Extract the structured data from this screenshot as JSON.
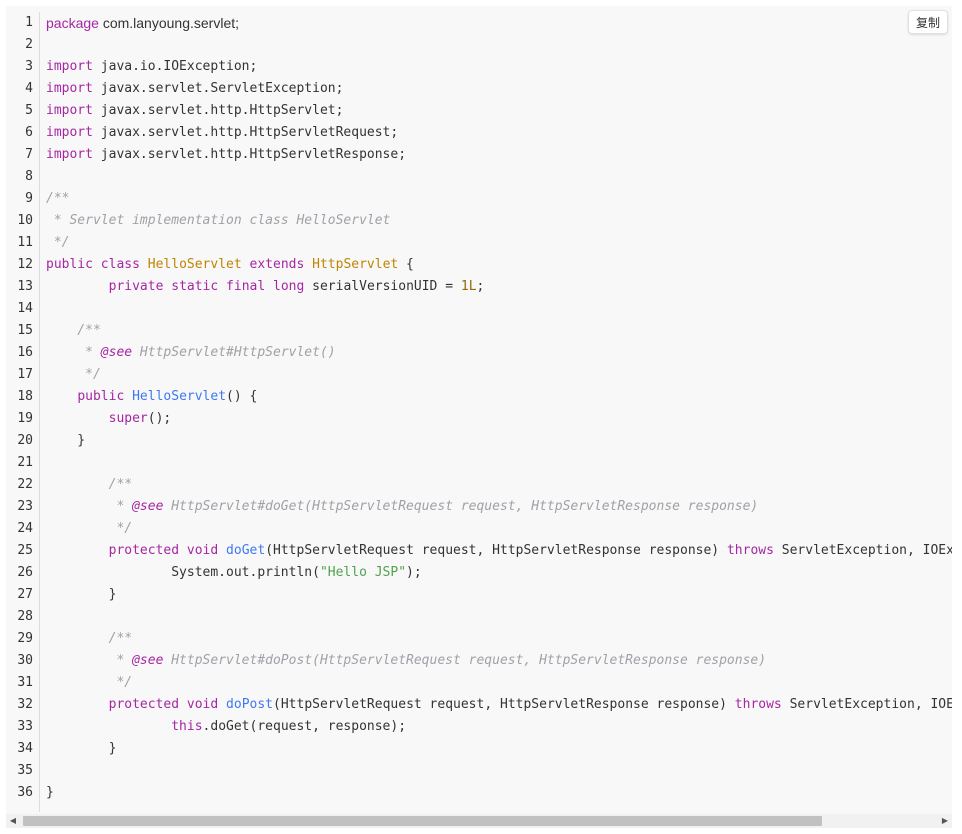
{
  "copy_button": {
    "label": "复制"
  },
  "colors": {
    "background": "#f8f8f8",
    "keyword": "#a626a4",
    "class_name": "#c18401",
    "function_name": "#4078f2",
    "string": "#50a14f",
    "number": "#986801",
    "comment": "#a0a1a7"
  },
  "scrollbar": {
    "left_arrow_icon": "◀",
    "right_arrow_icon": "▶",
    "thumb_fraction": 0.87
  },
  "lines": [
    {
      "n": "1",
      "tokens": [
        {
          "t": "package",
          "c": "kw prose"
        },
        {
          "t": " com.lanyoung.servlet;",
          "c": "prose"
        }
      ]
    },
    {
      "n": "2",
      "tokens": []
    },
    {
      "n": "3",
      "tokens": [
        {
          "t": "import",
          "c": "kw"
        },
        {
          "t": " java.io.IOException;",
          "c": ""
        }
      ]
    },
    {
      "n": "4",
      "tokens": [
        {
          "t": "import",
          "c": "kw"
        },
        {
          "t": " javax.servlet.ServletException;",
          "c": ""
        }
      ]
    },
    {
      "n": "5",
      "tokens": [
        {
          "t": "import",
          "c": "kw"
        },
        {
          "t": " javax.servlet.http.HttpServlet;",
          "c": ""
        }
      ]
    },
    {
      "n": "6",
      "tokens": [
        {
          "t": "import",
          "c": "kw"
        },
        {
          "t": " javax.servlet.http.HttpServletRequest;",
          "c": ""
        }
      ]
    },
    {
      "n": "7",
      "tokens": [
        {
          "t": "import",
          "c": "kw"
        },
        {
          "t": " javax.servlet.http.HttpServletResponse;",
          "c": ""
        }
      ]
    },
    {
      "n": "8",
      "tokens": []
    },
    {
      "n": "9",
      "tokens": [
        {
          "t": "/**",
          "c": "cmt"
        }
      ]
    },
    {
      "n": "10",
      "tokens": [
        {
          "t": " * Servlet implementation class HelloServlet",
          "c": "cmt"
        }
      ]
    },
    {
      "n": "11",
      "tokens": [
        {
          "t": " */",
          "c": "cmt"
        }
      ]
    },
    {
      "n": "12",
      "tokens": [
        {
          "t": "public",
          "c": "kw"
        },
        {
          "t": " ",
          "c": ""
        },
        {
          "t": "class",
          "c": "kw"
        },
        {
          "t": " ",
          "c": ""
        },
        {
          "t": "HelloServlet",
          "c": "cls"
        },
        {
          "t": " ",
          "c": ""
        },
        {
          "t": "extends",
          "c": "kw"
        },
        {
          "t": " ",
          "c": ""
        },
        {
          "t": "HttpServlet",
          "c": "cls"
        },
        {
          "t": " {",
          "c": ""
        }
      ]
    },
    {
      "n": "13",
      "tokens": [
        {
          "t": "        ",
          "c": ""
        },
        {
          "t": "private",
          "c": "kw"
        },
        {
          "t": " ",
          "c": ""
        },
        {
          "t": "static",
          "c": "kw"
        },
        {
          "t": " ",
          "c": ""
        },
        {
          "t": "final",
          "c": "kw"
        },
        {
          "t": " ",
          "c": ""
        },
        {
          "t": "long",
          "c": "kw"
        },
        {
          "t": " serialVersionUID = ",
          "c": ""
        },
        {
          "t": "1L",
          "c": "num"
        },
        {
          "t": ";",
          "c": ""
        }
      ]
    },
    {
      "n": "14",
      "tokens": []
    },
    {
      "n": "15",
      "tokens": [
        {
          "t": "    /**",
          "c": "cmt"
        }
      ]
    },
    {
      "n": "16",
      "tokens": [
        {
          "t": "     * ",
          "c": "cmt"
        },
        {
          "t": "@see",
          "c": "doctag"
        },
        {
          "t": " HttpServlet#HttpServlet()",
          "c": "cmt"
        }
      ]
    },
    {
      "n": "17",
      "tokens": [
        {
          "t": "     */",
          "c": "cmt"
        }
      ]
    },
    {
      "n": "18",
      "tokens": [
        {
          "t": "    ",
          "c": ""
        },
        {
          "t": "public",
          "c": "kw"
        },
        {
          "t": " ",
          "c": ""
        },
        {
          "t": "HelloServlet",
          "c": "fn"
        },
        {
          "t": "() {",
          "c": ""
        }
      ]
    },
    {
      "n": "19",
      "tokens": [
        {
          "t": "        ",
          "c": ""
        },
        {
          "t": "super",
          "c": "kw"
        },
        {
          "t": "();",
          "c": ""
        }
      ]
    },
    {
      "n": "20",
      "tokens": [
        {
          "t": "    }",
          "c": ""
        }
      ]
    },
    {
      "n": "21",
      "tokens": []
    },
    {
      "n": "22",
      "tokens": [
        {
          "t": "        /**",
          "c": "cmt"
        }
      ]
    },
    {
      "n": "23",
      "tokens": [
        {
          "t": "         * ",
          "c": "cmt"
        },
        {
          "t": "@see",
          "c": "doctag"
        },
        {
          "t": " HttpServlet#doGet(HttpServletRequest request, HttpServletResponse response)",
          "c": "cmt"
        }
      ]
    },
    {
      "n": "24",
      "tokens": [
        {
          "t": "         */",
          "c": "cmt"
        }
      ]
    },
    {
      "n": "25",
      "tokens": [
        {
          "t": "        ",
          "c": ""
        },
        {
          "t": "protected",
          "c": "kw"
        },
        {
          "t": " ",
          "c": ""
        },
        {
          "t": "void",
          "c": "kw"
        },
        {
          "t": " ",
          "c": ""
        },
        {
          "t": "doGet",
          "c": "fn"
        },
        {
          "t": "(HttpServletRequest request, HttpServletResponse response) ",
          "c": ""
        },
        {
          "t": "throws",
          "c": "kw"
        },
        {
          "t": " ServletException, IOExce",
          "c": ""
        }
      ]
    },
    {
      "n": "26",
      "tokens": [
        {
          "t": "                System.out.println(",
          "c": ""
        },
        {
          "t": "\"Hello JSP\"",
          "c": "str"
        },
        {
          "t": ");",
          "c": ""
        }
      ]
    },
    {
      "n": "27",
      "tokens": [
        {
          "t": "        }",
          "c": ""
        }
      ]
    },
    {
      "n": "28",
      "tokens": []
    },
    {
      "n": "29",
      "tokens": [
        {
          "t": "        /**",
          "c": "cmt"
        }
      ]
    },
    {
      "n": "30",
      "tokens": [
        {
          "t": "         * ",
          "c": "cmt"
        },
        {
          "t": "@see",
          "c": "doctag"
        },
        {
          "t": " HttpServlet#doPost(HttpServletRequest request, HttpServletResponse response)",
          "c": "cmt"
        }
      ]
    },
    {
      "n": "31",
      "tokens": [
        {
          "t": "         */",
          "c": "cmt"
        }
      ]
    },
    {
      "n": "32",
      "tokens": [
        {
          "t": "        ",
          "c": ""
        },
        {
          "t": "protected",
          "c": "kw"
        },
        {
          "t": " ",
          "c": ""
        },
        {
          "t": "void",
          "c": "kw"
        },
        {
          "t": " ",
          "c": ""
        },
        {
          "t": "doPost",
          "c": "fn"
        },
        {
          "t": "(HttpServletRequest request, HttpServletResponse response) ",
          "c": ""
        },
        {
          "t": "throws",
          "c": "kw"
        },
        {
          "t": " ServletException, IOExc",
          "c": ""
        }
      ]
    },
    {
      "n": "33",
      "tokens": [
        {
          "t": "                ",
          "c": ""
        },
        {
          "t": "this",
          "c": "kw"
        },
        {
          "t": ".doGet(request, response);",
          "c": ""
        }
      ]
    },
    {
      "n": "34",
      "tokens": [
        {
          "t": "        }",
          "c": ""
        }
      ]
    },
    {
      "n": "35",
      "tokens": []
    },
    {
      "n": "36",
      "tokens": [
        {
          "t": "}",
          "c": ""
        }
      ]
    }
  ]
}
